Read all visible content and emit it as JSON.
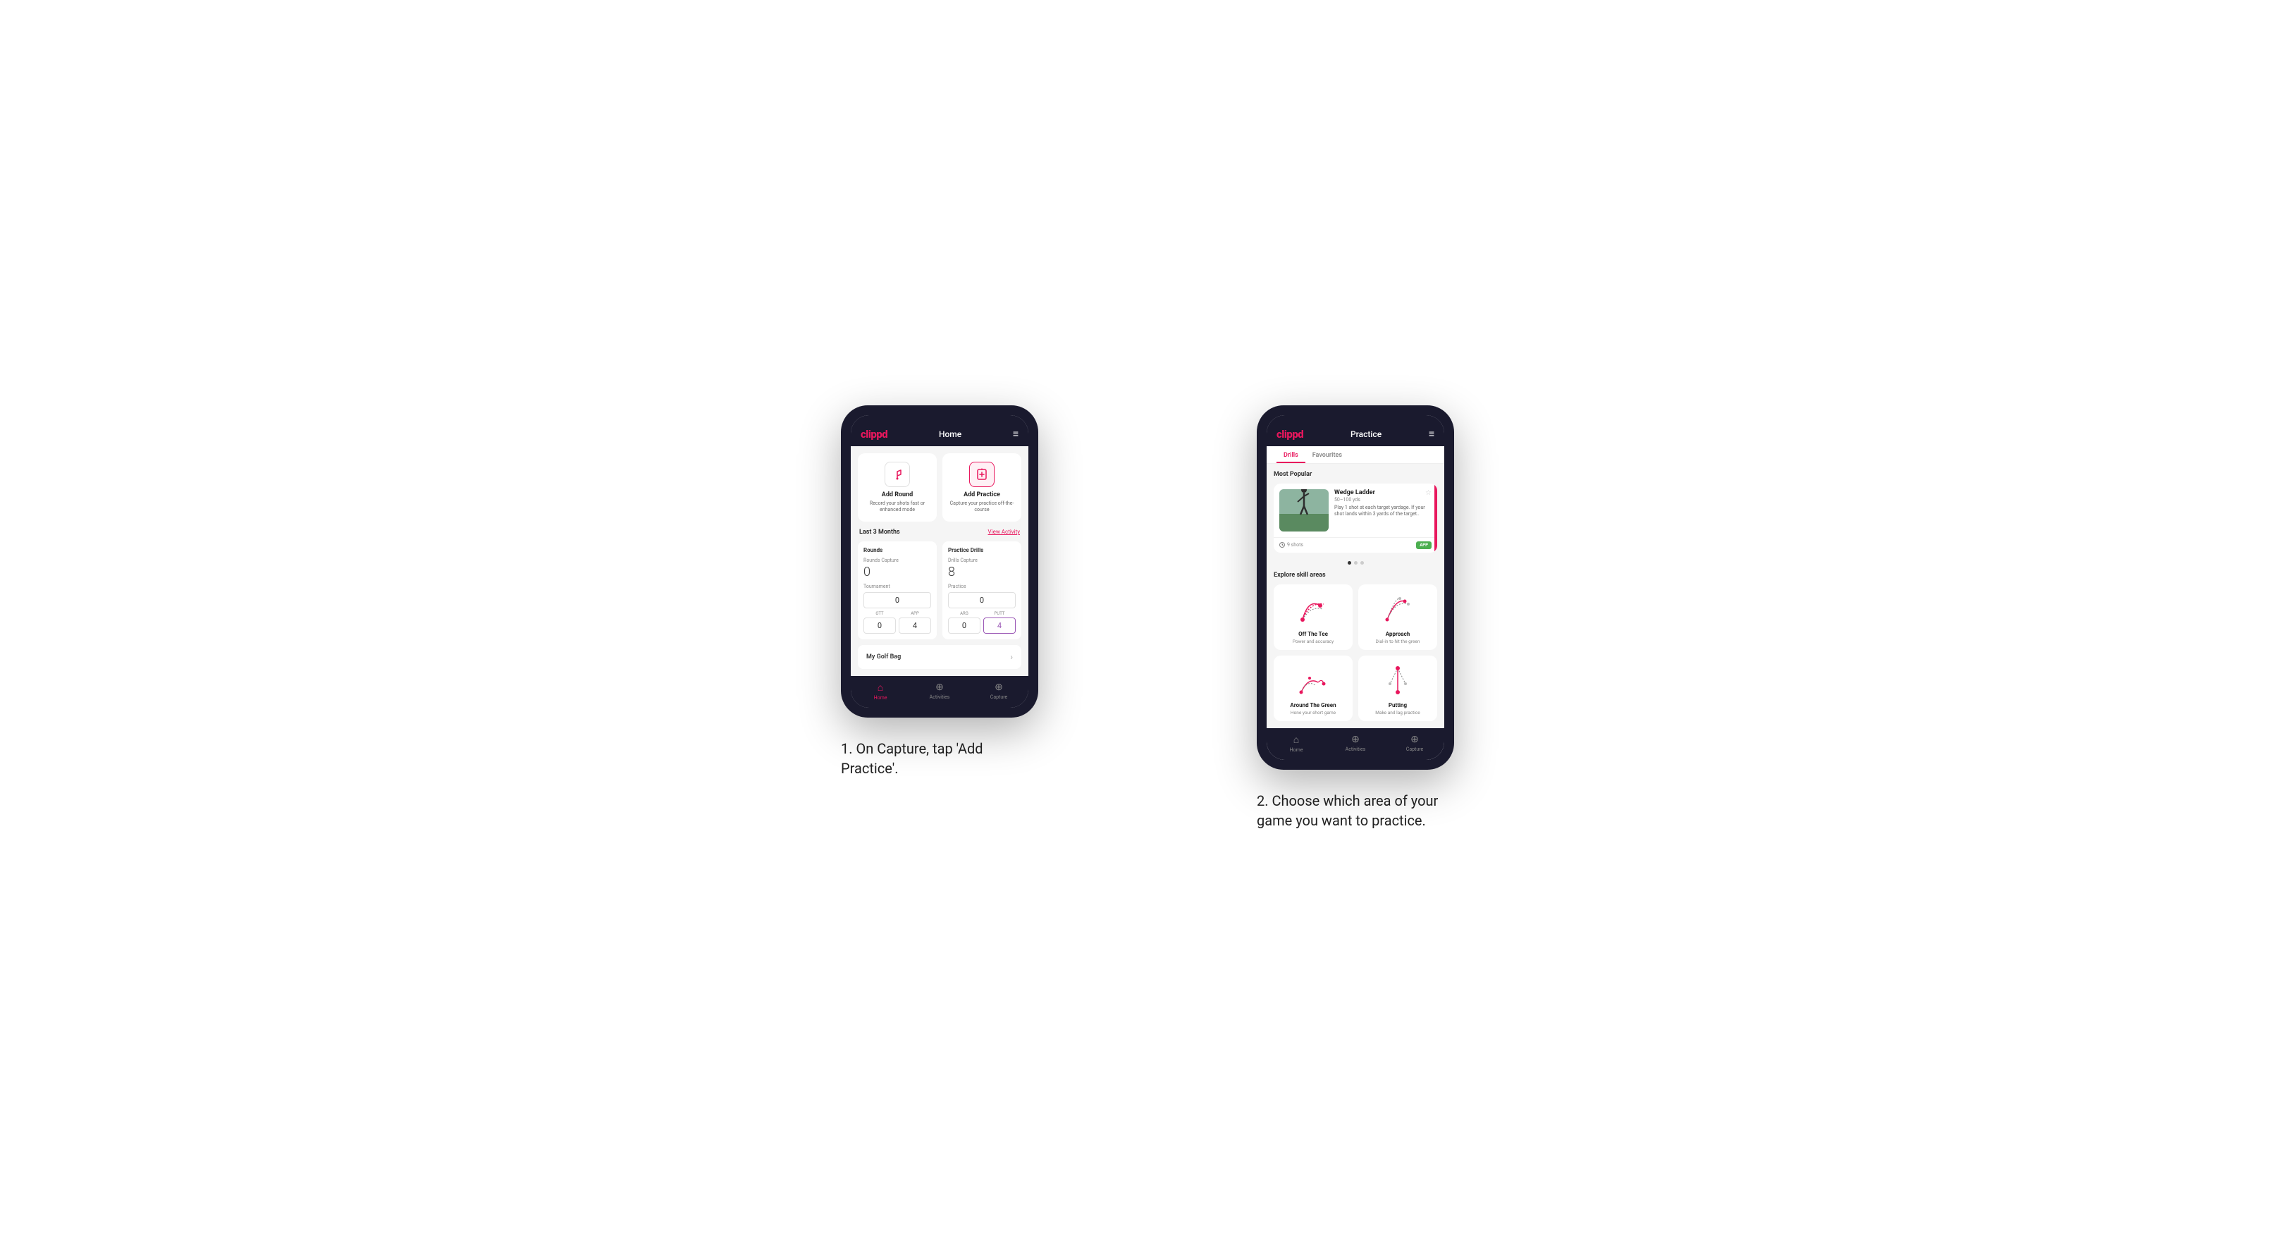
{
  "phone1": {
    "header": {
      "logo": "clippd",
      "title": "Home",
      "menu_icon": "≡"
    },
    "add_round": {
      "title": "Add Round",
      "description": "Record your shots fast or enhanced mode"
    },
    "add_practice": {
      "title": "Add Practice",
      "description": "Capture your practice off-the-course"
    },
    "stats": {
      "period": "Last 3 Months",
      "view_activity": "View Activity",
      "rounds": {
        "title": "Rounds",
        "rounds_capture_label": "Rounds Capture",
        "rounds_capture_value": "0",
        "tournament_label": "Tournament",
        "tournament_value": "0",
        "ott_label": "OTT",
        "ott_value": "0",
        "app_label": "APP",
        "app_value": "4"
      },
      "practice_drills": {
        "title": "Practice Drills",
        "drills_capture_label": "Drills Capture",
        "drills_capture_value": "8",
        "practice_label": "Practice",
        "practice_value": "0",
        "arg_label": "ARG",
        "arg_value": "0",
        "putt_label": "PUTT",
        "putt_value": "4"
      }
    },
    "golf_bag": {
      "label": "My Golf Bag"
    },
    "nav": {
      "home": "Home",
      "activities": "Activities",
      "capture": "Capture"
    }
  },
  "phone2": {
    "header": {
      "logo": "clippd",
      "title": "Practice",
      "menu_icon": "≡"
    },
    "tabs": {
      "drills": "Drills",
      "favourites": "Favourites"
    },
    "most_popular": {
      "title": "Most Popular",
      "featured": {
        "name": "Wedge Ladder",
        "yds": "50–100 yds",
        "description": "Play 1 shot at each target yardage. If your shot lands within 3 yards of the target..",
        "shots": "9 shots",
        "badge": "APP"
      }
    },
    "explore": {
      "title": "Explore skill areas",
      "skills": [
        {
          "name": "Off The Tee",
          "desc": "Power and accuracy",
          "diagram": "ott"
        },
        {
          "name": "Approach",
          "desc": "Dial-in to hit the green",
          "diagram": "approach"
        },
        {
          "name": "Around The Green",
          "desc": "Hone your short game",
          "diagram": "atg"
        },
        {
          "name": "Putting",
          "desc": "Make and lag practice",
          "diagram": "putt"
        }
      ]
    },
    "nav": {
      "home": "Home",
      "activities": "Activities",
      "capture": "Capture"
    }
  },
  "captions": {
    "caption1": "1. On Capture, tap 'Add Practice'.",
    "caption2": "2. Choose which area of your game you want to practice."
  },
  "colors": {
    "brand_pink": "#e8175d",
    "dark_bg": "#1a1a2e",
    "light_gray": "#f5f5f5"
  }
}
